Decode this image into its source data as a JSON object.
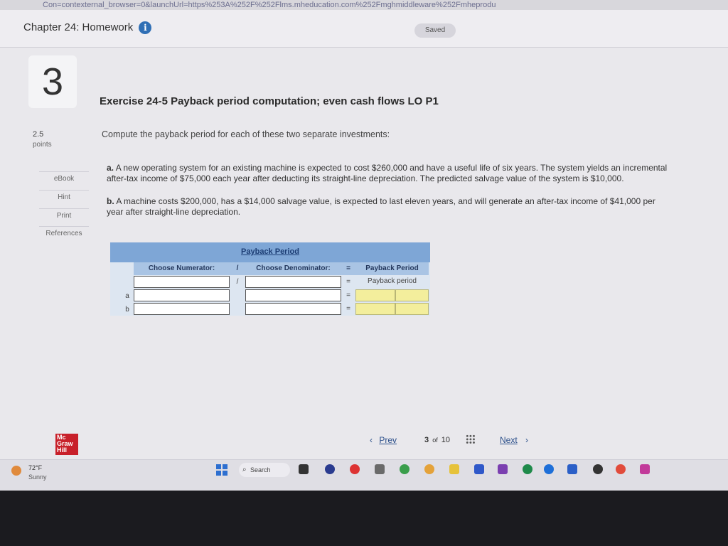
{
  "browser": {
    "url_fragment": "Con=contexternal_browser=0&launchUrl=https%253A%252F%252Flms.mheducation.com%252Fmghmiddleware%252Fmheprodu"
  },
  "header": {
    "chapter_title": "Chapter 24: Homework",
    "info_glyph": "i",
    "saved_label": "Saved"
  },
  "question": {
    "number": "3",
    "points_value": "2.5",
    "points_label": "points"
  },
  "sidebar": {
    "buttons": [
      {
        "label": "eBook"
      },
      {
        "label": "Hint"
      },
      {
        "label": "Print"
      },
      {
        "label": "References"
      }
    ]
  },
  "exercise": {
    "title": "Exercise 24-5 Payback period computation; even cash flows LO P1",
    "intro": "Compute the payback period for each of these two separate investments:",
    "parts": [
      {
        "label": "a.",
        "text": "A new operating system for an existing machine is expected to cost $260,000 and have a useful life of six years. The system yields an incremental after-tax income of $75,000 each year after deducting its straight-line depreciation. The predicted salvage value of the system is $10,000."
      },
      {
        "label": "b.",
        "text": "A machine costs $200,000, has a $14,000 salvage value, is expected to last eleven years, and will generate an after-tax income of $41,000 per year after straight-line depreciation."
      }
    ]
  },
  "worksheet": {
    "title": "Payback Period",
    "col_numerator": "Choose Numerator:",
    "op_divide": "/",
    "col_denominator": "Choose Denominator:",
    "op_equals": "=",
    "col_result": "Payback Period",
    "result_subheader": "Payback period",
    "rows": [
      {
        "label": "a",
        "numerator": "",
        "denominator": "",
        "result": ""
      },
      {
        "label": "b",
        "numerator": "",
        "denominator": "",
        "result": ""
      }
    ]
  },
  "footer": {
    "logo_text": "Mc Graw Hill",
    "prev_label": "Prev",
    "page_current": "3",
    "page_of": "of",
    "page_total": "10",
    "next_label": "Next"
  },
  "taskbar": {
    "temperature": "72°F",
    "condition": "Sunny",
    "search_label": "Search"
  }
}
